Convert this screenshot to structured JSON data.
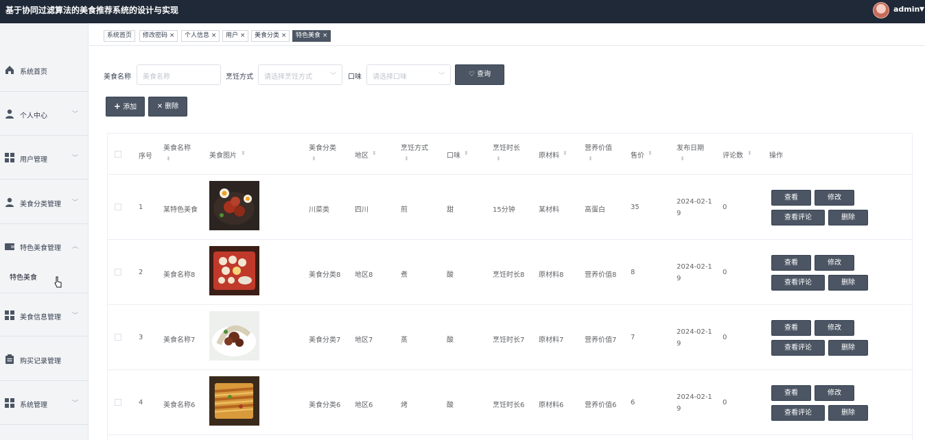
{
  "app": {
    "title": "基于协同过滤算法的美食推荐系统的设计与实现",
    "user": "admin"
  },
  "sidebar": {
    "items": [
      {
        "label": "系统首页",
        "icon": "home-icon"
      },
      {
        "label": "个人中心",
        "icon": "person-icon"
      },
      {
        "label": "用户管理",
        "icon": "grid-icon"
      },
      {
        "label": "美食分类管理",
        "icon": "person-icon"
      },
      {
        "label": "特色美食管理",
        "icon": "wallet-icon"
      },
      {
        "label": "美食信息管理",
        "icon": "grid-icon"
      },
      {
        "label": "购买记录管理",
        "icon": "clipboard-icon"
      },
      {
        "label": "系统管理",
        "icon": "grid-icon"
      }
    ],
    "sub_item": "特色美食"
  },
  "tabs": [
    "系统首页",
    "修改密码",
    "个人信息",
    "用户",
    "美食分类",
    "特色美食"
  ],
  "search": {
    "name_label": "美食名称",
    "name_placeholder": "美食名称",
    "method_label": "烹饪方式",
    "method_placeholder": "请选择烹饪方式",
    "taste_label": "口味",
    "taste_placeholder": "请选择口味",
    "query_button": "查询"
  },
  "actions": {
    "add": "添加",
    "delete": "删除"
  },
  "table": {
    "headers": {
      "index": "序号",
      "name": "美食名称",
      "image": "美食图片",
      "category": "美食分类",
      "region": "地区",
      "method": "烹饪方式",
      "taste": "口味",
      "duration": "烹饪时长",
      "ingredients": "原材料",
      "nutrition": "营养价值",
      "price": "售价",
      "date": "发布日期",
      "comments": "评论数",
      "ops": "操作"
    },
    "row_buttons": {
      "view": "查看",
      "edit": "修改",
      "comments": "查看评论",
      "delete": "删除"
    },
    "rows": [
      {
        "index": "1",
        "name": "某特色美食",
        "category": "川菜类",
        "region": "四川",
        "method": "煎",
        "taste": "甜",
        "duration": "15分钟",
        "ingredients": "某材料",
        "nutrition": "高蛋白",
        "price": "35",
        "date_a": "2024-02-1",
        "date_b": "9",
        "comments": "0",
        "img": "dish-1"
      },
      {
        "index": "2",
        "name": "美食名称8",
        "category": "美食分类8",
        "region": "地区8",
        "method": "煮",
        "taste": "酸",
        "duration": "烹饪时长8",
        "ingredients": "原材料8",
        "nutrition": "营养价值8",
        "price": "8",
        "date_a": "2024-02-1",
        "date_b": "9",
        "comments": "0",
        "img": "dish-2"
      },
      {
        "index": "3",
        "name": "美食名称7",
        "category": "美食分类7",
        "region": "地区7",
        "method": "蒸",
        "taste": "酸",
        "duration": "烹饪时长7",
        "ingredients": "原材料7",
        "nutrition": "营养价值7",
        "price": "7",
        "date_a": "2024-02-1",
        "date_b": "9",
        "comments": "0",
        "img": "dish-3"
      },
      {
        "index": "4",
        "name": "美食名称6",
        "category": "美食分类6",
        "region": "地区6",
        "method": "烤",
        "taste": "酸",
        "duration": "烹饪时长6",
        "ingredients": "原材料6",
        "nutrition": "营养价值6",
        "price": "6",
        "date_a": "2024-02-1",
        "date_b": "9",
        "comments": "0",
        "img": "dish-4"
      }
    ]
  },
  "colors": {
    "topbar": "#1f2937",
    "button": "#4b5563"
  }
}
